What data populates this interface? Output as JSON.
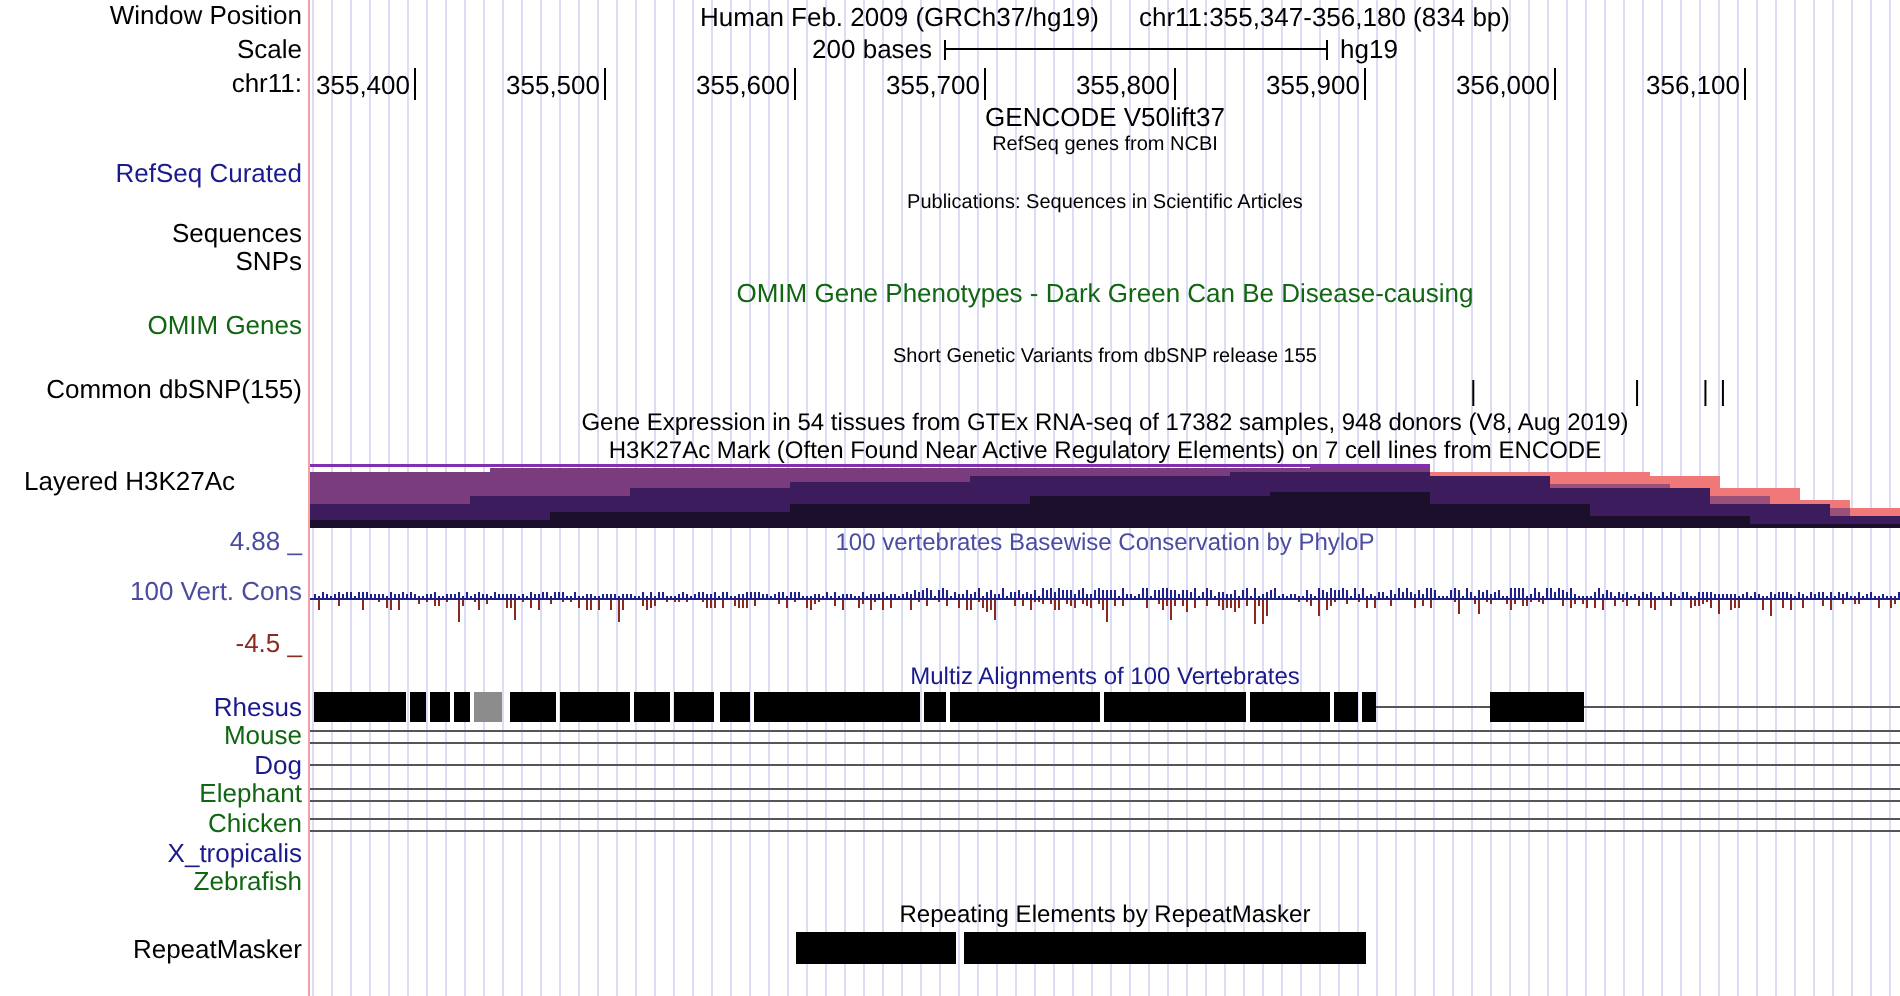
{
  "position": {
    "label": "Window Position",
    "assembly": "Human Feb. 2009 (GRCh37/hg19)",
    "range": "chr11:355,347-356,180 (834 bp)"
  },
  "scale": {
    "label": "Scale",
    "length": "200 bases",
    "database": "hg19"
  },
  "ruler": {
    "label": "chr11:",
    "ticks": [
      "355,400",
      "355,500",
      "355,600",
      "355,700",
      "355,800",
      "355,900",
      "356,000",
      "356,100"
    ]
  },
  "tracks": [
    {
      "kind": "gencode",
      "title": "GENCODE V50lift37"
    },
    {
      "kind": "genes",
      "title": "RefSeq genes from NCBI",
      "label": "RefSeq Curated",
      "color": "#1a1a8c"
    },
    {
      "kind": "publications",
      "title": "Publications: Sequences in Scientific Articles"
    },
    {
      "kind": "label",
      "label": "Sequences",
      "color": "#000000"
    },
    {
      "kind": "label",
      "label": "SNPs",
      "color": "#000000"
    },
    {
      "kind": "omim",
      "title": "OMIM Gene Phenotypes - Dark Green Can Be Disease-causing",
      "label": "OMIM Genes",
      "color": "#116611"
    },
    {
      "kind": "snp",
      "title": "Short Genetic Variants from dbSNP release 155",
      "label": "Common dbSNP(155)",
      "color": "#000000"
    },
    {
      "kind": "gtex",
      "title": "Gene Expression in 54 tissues from GTEx RNA-seq of 17382 samples, 948 donors (V8, Aug 2019)"
    },
    {
      "kind": "layered",
      "title": "H3K27Ac Mark (Often Found Near Active Regulatory Elements) on 7 cell lines from ENCODE",
      "label": "Layered H3K27Ac",
      "color": "#000000"
    },
    {
      "kind": "conservation",
      "title": "100 vertebrates Basewise Conservation by PhyloP",
      "label": "100 Vert. Cons",
      "color": "#4b4ba0",
      "max": "4.88 _",
      "min": "-4.5 _"
    },
    {
      "kind": "multiz",
      "title": "Multiz Alignments of 100 Vertebrates",
      "color": "#1a1a8c",
      "species": [
        {
          "name": "Rhesus",
          "color": "#1a1a8c",
          "kind": "blocks"
        },
        {
          "name": "Mouse",
          "color": "#116611",
          "kind": "double"
        },
        {
          "name": "Dog",
          "color": "#1a1a8c",
          "kind": "single"
        },
        {
          "name": "Elephant",
          "color": "#116611",
          "kind": "double"
        },
        {
          "name": "Chicken",
          "color": "#116611",
          "kind": "double"
        },
        {
          "name": "X_tropicalis",
          "color": "#1a1a8c",
          "kind": "none"
        },
        {
          "name": "Zebrafish",
          "color": "#116611",
          "kind": "none"
        }
      ]
    },
    {
      "kind": "repeats",
      "title": "Repeating Elements by RepeatMasker",
      "label": "RepeatMasker",
      "color": "#000000"
    }
  ]
}
